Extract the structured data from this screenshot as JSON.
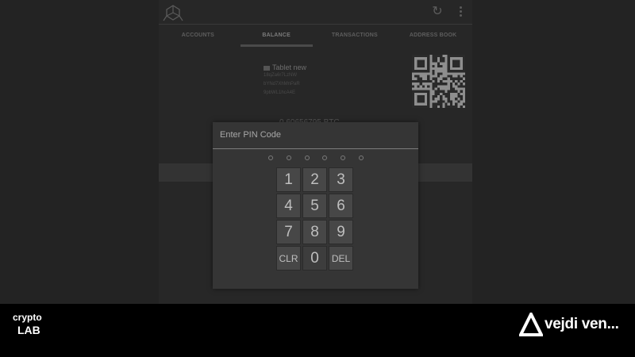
{
  "tabs": [
    {
      "label": "ACCOUNTS"
    },
    {
      "label": "BALANCE"
    },
    {
      "label": "TRANSACTIONS"
    },
    {
      "label": "ADDRESS BOOK"
    }
  ],
  "active_tab": "BALANCE",
  "wallet": {
    "name": "Tablet new",
    "address_lines": [
      "18qZa6r7LzNW",
      "bYNd7XhMnPaR",
      "9pbWL1hcA4E"
    ],
    "balance": "0.60656795 BTC"
  },
  "icons": {
    "logo": "cube-logo-icon",
    "refresh": "refresh-icon",
    "overflow": "overflow-menu-icon",
    "wallet": "wallet-tag-icon"
  },
  "dialog": {
    "title": "Enter PIN Code",
    "pin_length": 6,
    "keys": [
      {
        "label": "1"
      },
      {
        "label": "2"
      },
      {
        "label": "3"
      },
      {
        "label": "4"
      },
      {
        "label": "5"
      },
      {
        "label": "6"
      },
      {
        "label": "7"
      },
      {
        "label": "8"
      },
      {
        "label": "9"
      },
      {
        "label": "CLR"
      },
      {
        "label": "0"
      },
      {
        "label": "DEL"
      }
    ]
  },
  "footer": {
    "brand_left_line1": "crypto",
    "brand_left_line2": "LAB",
    "brand_right": "vejdi ven..."
  }
}
